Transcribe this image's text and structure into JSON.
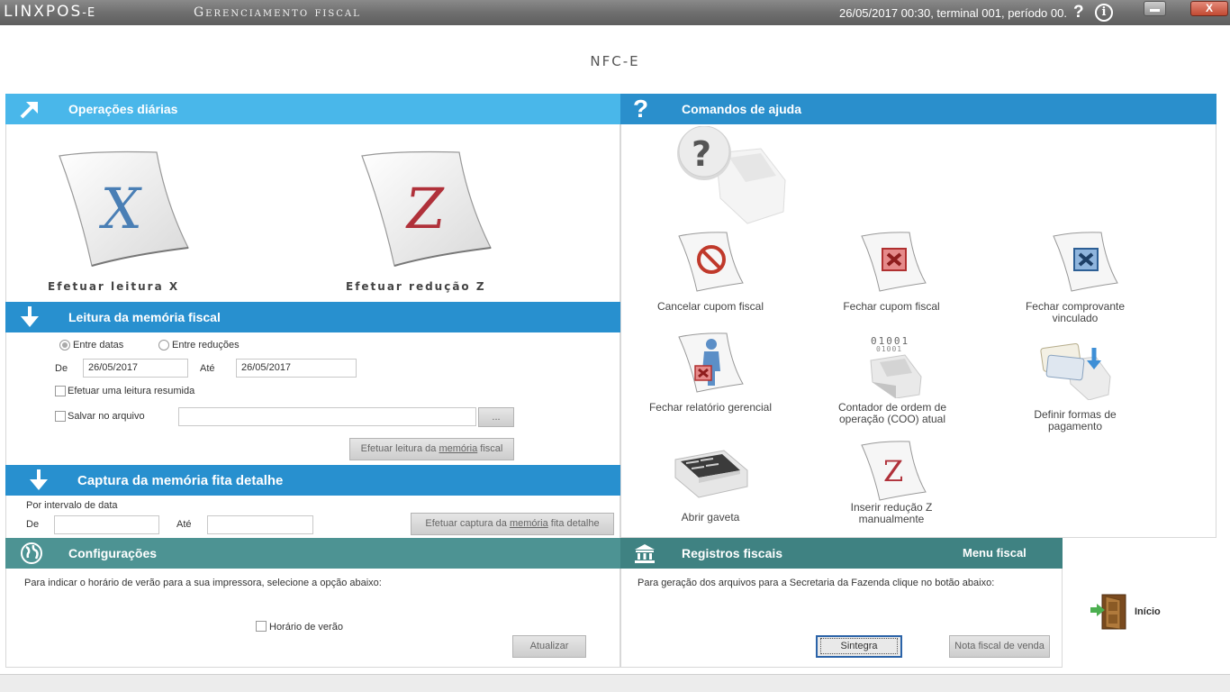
{
  "titlebar": {
    "brand": "LINXPOS",
    "brand_suffix": "-E",
    "app_title": "Gerenciamento fiscal",
    "status": "26/05/2017 00:30, terminal 001, período 00.",
    "help": "?",
    "info": "i",
    "close": "X"
  },
  "page": {
    "title": "NFC-E"
  },
  "operacoes": {
    "title": "Operações diárias",
    "x_letter": "X",
    "z_letter": "Z",
    "leitura_x": "Efetuar leitura X",
    "reducao_z": "Efetuar redução Z"
  },
  "leitura": {
    "title": "Leitura da memória fiscal",
    "entre_datas": "Entre datas",
    "entre_reducoes": "Entre reduções",
    "de_label": "De",
    "de_value": "26/05/2017",
    "ate_label": "Até",
    "ate_value": "26/05/2017",
    "resumida": "Efetuar uma leitura resumida",
    "salvar": "Salvar no arquivo",
    "browse": "...",
    "btn_pre": "Efetuar leitura da ",
    "btn_under": "memória",
    "btn_post": " fiscal"
  },
  "captura": {
    "title": "Captura da memória fita detalhe",
    "intervalo": "Por intervalo de data",
    "de_label": "De",
    "ate_label": "Até",
    "btn_pre": "Efetuar captura da ",
    "btn_under": "memória",
    "btn_post": " fita detalhe"
  },
  "configuracoes": {
    "title": "Configurações",
    "text": "Para indicar o horário de verão para a sua impressora, selecione a opção abaixo:",
    "horario": "Horário de verão",
    "atualizar": "Atualizar"
  },
  "ajuda": {
    "title": "Comandos de ajuda",
    "q": "?",
    "cancelar": "Cancelar cupom fiscal",
    "fechar_cupom": "Fechar cupom fiscal",
    "fechar_comprovante": "Fechar comprovante vinculado",
    "fechar_relatorio": "Fechar relatório gerencial",
    "contador": "Contador de ordem de operação (COO) atual",
    "binary1": "01001",
    "binary2": "01001",
    "definir": "Definir formas de pagamento",
    "abrir_gaveta": "Abrir gaveta",
    "inserir_reducao": "Inserir redução Z manualmente",
    "z_letter": "Z"
  },
  "registros": {
    "title": "Registros fiscais",
    "menu": "Menu fiscal",
    "text": "Para geração dos arquivos para a Secretaria da Fazenda clique no botão abaixo:",
    "sintegra": "Sintegra",
    "nota": "Nota fiscal de venda"
  },
  "inicio": {
    "label": "Início"
  },
  "colors": {
    "band_light": "#49b7ea",
    "band_dark": "#2890cf",
    "band_teal": "#4d9393"
  }
}
